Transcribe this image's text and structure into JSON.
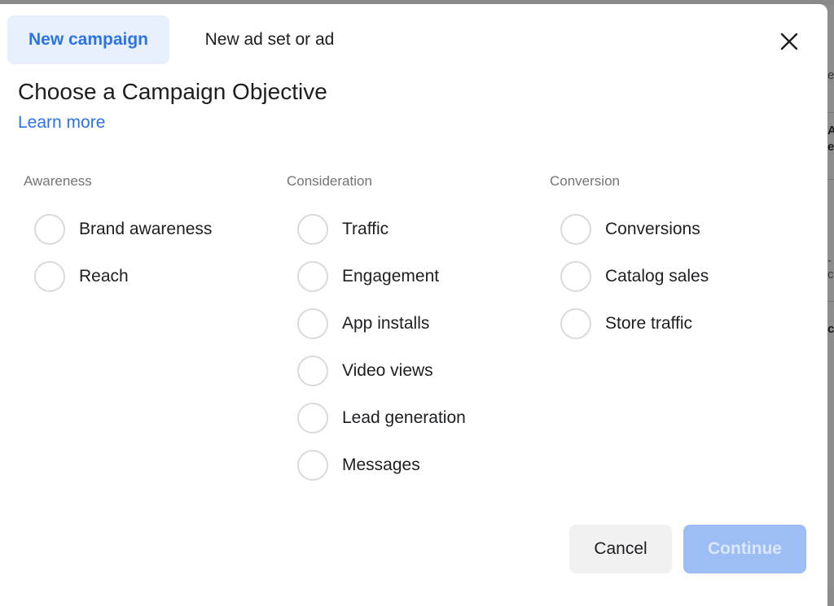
{
  "tabs": [
    {
      "label": "New campaign",
      "active": true
    },
    {
      "label": "New ad set or ad",
      "active": false
    }
  ],
  "close_icon": "close-icon",
  "heading": "Choose a Campaign Objective",
  "learn_more": "Learn more",
  "columns": [
    {
      "label": "Awareness",
      "options": [
        "Brand awareness",
        "Reach"
      ]
    },
    {
      "label": "Consideration",
      "options": [
        "Traffic",
        "Engagement",
        "App installs",
        "Video views",
        "Lead generation",
        "Messages"
      ]
    },
    {
      "label": "Conversion",
      "options": [
        "Conversions",
        "Catalog sales",
        "Store traffic"
      ]
    }
  ],
  "footer": {
    "cancel": "Cancel",
    "continue": "Continue",
    "continue_disabled": true
  },
  "background_fragments": [
    "ev",
    "A",
    "ef",
    "-c",
    "c"
  ],
  "colors": {
    "accent": "#2b74e3",
    "accent_bg": "#e8f0fd",
    "continue_disabled_bg": "#9dbdf5"
  }
}
